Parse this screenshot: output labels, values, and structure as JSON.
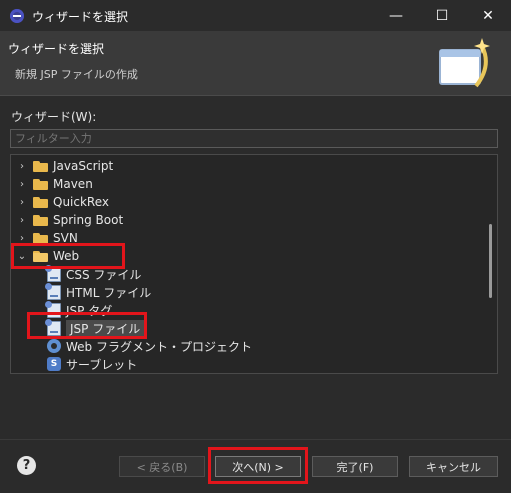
{
  "window": {
    "title": "ウィザードを選択",
    "controls": {
      "minimize": "—",
      "maximize": "☐",
      "close": "✕"
    }
  },
  "header": {
    "title": "ウィザードを選択",
    "subtitle": "新規 JSP ファイルの作成"
  },
  "wizard_label": "ウィザード(W):",
  "filter": {
    "placeholder": "フィルター入力",
    "value": ""
  },
  "tree": {
    "items": [
      {
        "label": "JavaScript",
        "expanded": false
      },
      {
        "label": "Maven",
        "expanded": false
      },
      {
        "label": "QuickRex",
        "expanded": false
      },
      {
        "label": "Spring Boot",
        "expanded": false
      },
      {
        "label": "SVN",
        "expanded": false
      },
      {
        "label": "Web",
        "expanded": true,
        "children": [
          {
            "label": "CSS ファイル",
            "icon": "css-file-icon"
          },
          {
            "label": "HTML ファイル",
            "icon": "html-file-icon"
          },
          {
            "label": "JSP タグ",
            "icon": "jsp-tag-icon"
          },
          {
            "label": "JSP ファイル",
            "icon": "jsp-file-icon",
            "selected": true
          },
          {
            "label": "Web フラグメント・プロジェクト",
            "icon": "web-fragment-project-icon"
          },
          {
            "label": "サーブレット",
            "icon": "servlet-icon"
          }
        ]
      }
    ]
  },
  "buttons": {
    "help": "?",
    "back": "< 戻る(B)",
    "next": "次へ(N) >",
    "finish": "完了(F)",
    "cancel": "キャンセル"
  },
  "colors": {
    "highlight": "#e2151b",
    "background": "#2b2b2b",
    "header_background": "#3a3a3a"
  }
}
